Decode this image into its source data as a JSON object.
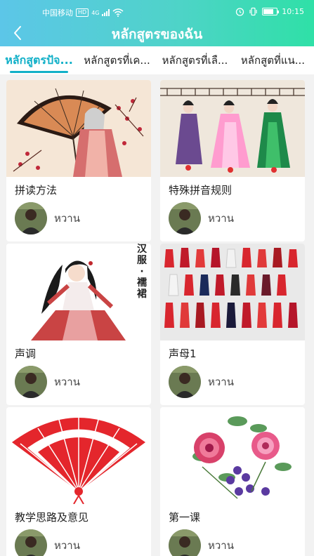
{
  "status_bar": {
    "carrier": "中国移动",
    "network_badge": "HD",
    "network_type": "4G",
    "time": "10:15"
  },
  "header": {
    "back_icon": "chevron-left-icon",
    "title": "หลักสูตรของฉัน"
  },
  "tabs": [
    {
      "label": "หลักสูตรปัจ...",
      "active": true
    },
    {
      "label": "หลักสูตรที่เค...",
      "active": false
    },
    {
      "label": "หลักสูตรที่เลื...",
      "active": false
    },
    {
      "label": "หลักสูตที่แน...",
      "active": false
    }
  ],
  "courses": [
    {
      "name": "拼读方法",
      "author": "หวาน",
      "thumbnail": "umbrella-lady-illustration"
    },
    {
      "name": "特殊拼音规则",
      "author": "หวาน",
      "thumbnail": "court-ladies-painting"
    },
    {
      "name": "声调",
      "author": "หวาน",
      "thumbnail": "hanfu-girl-illustration",
      "thumb_caption": [
        "汉",
        "服",
        "·",
        "襦",
        "裙"
      ]
    },
    {
      "name": "声母1",
      "author": "หวาน",
      "thumbnail": "qipao-dresses-grid"
    },
    {
      "name": "教学思路及意见",
      "author": "หวาน",
      "thumbnail": "red-paper-cut-fan"
    },
    {
      "name": "第一课",
      "author": "หวาน",
      "thumbnail": "peony-flowers-painting"
    }
  ],
  "colors": {
    "header_gradient_start": "#5cc6e8",
    "header_gradient_end": "#2fe0a7",
    "active_tab": "#12b0c8",
    "card_bg": "#ffffff",
    "page_bg": "#f2f2f2"
  }
}
